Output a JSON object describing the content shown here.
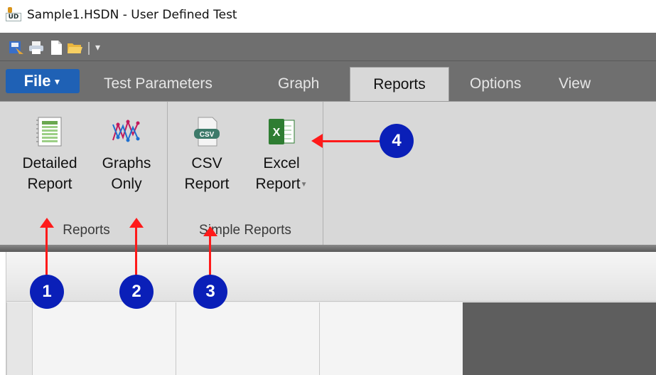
{
  "window": {
    "app_icon_text": "UD",
    "title": "Sample1.HSDN - User Defined Test"
  },
  "quick_access": {
    "icons": [
      "report-save-icon",
      "print-icon",
      "new-document-icon",
      "open-folder-icon"
    ],
    "more_glyph": "▾"
  },
  "tabs": {
    "file": "File",
    "test_parameters": "Test Parameters",
    "graph": "Graph",
    "reports": "Reports",
    "options": "Options",
    "view": "View"
  },
  "ribbon": {
    "reports_group": {
      "label": "Reports",
      "detailed_line1": "Detailed",
      "detailed_line2": "Report",
      "graphs_line1": "Graphs",
      "graphs_line2": "Only"
    },
    "simple_reports_group": {
      "label": "Simple Reports",
      "csv_icon_text": "CSV",
      "csv_line1": "CSV",
      "csv_line2": "Report",
      "excel_line1": "Excel",
      "excel_line2": "Report"
    }
  },
  "annotations": {
    "badge1": "1",
    "badge2": "2",
    "badge3": "3",
    "badge4": "4"
  },
  "colors": {
    "file_tab": "#1f61b5",
    "badge": "#0a1fb8",
    "arrow": "#ff1a1a"
  }
}
